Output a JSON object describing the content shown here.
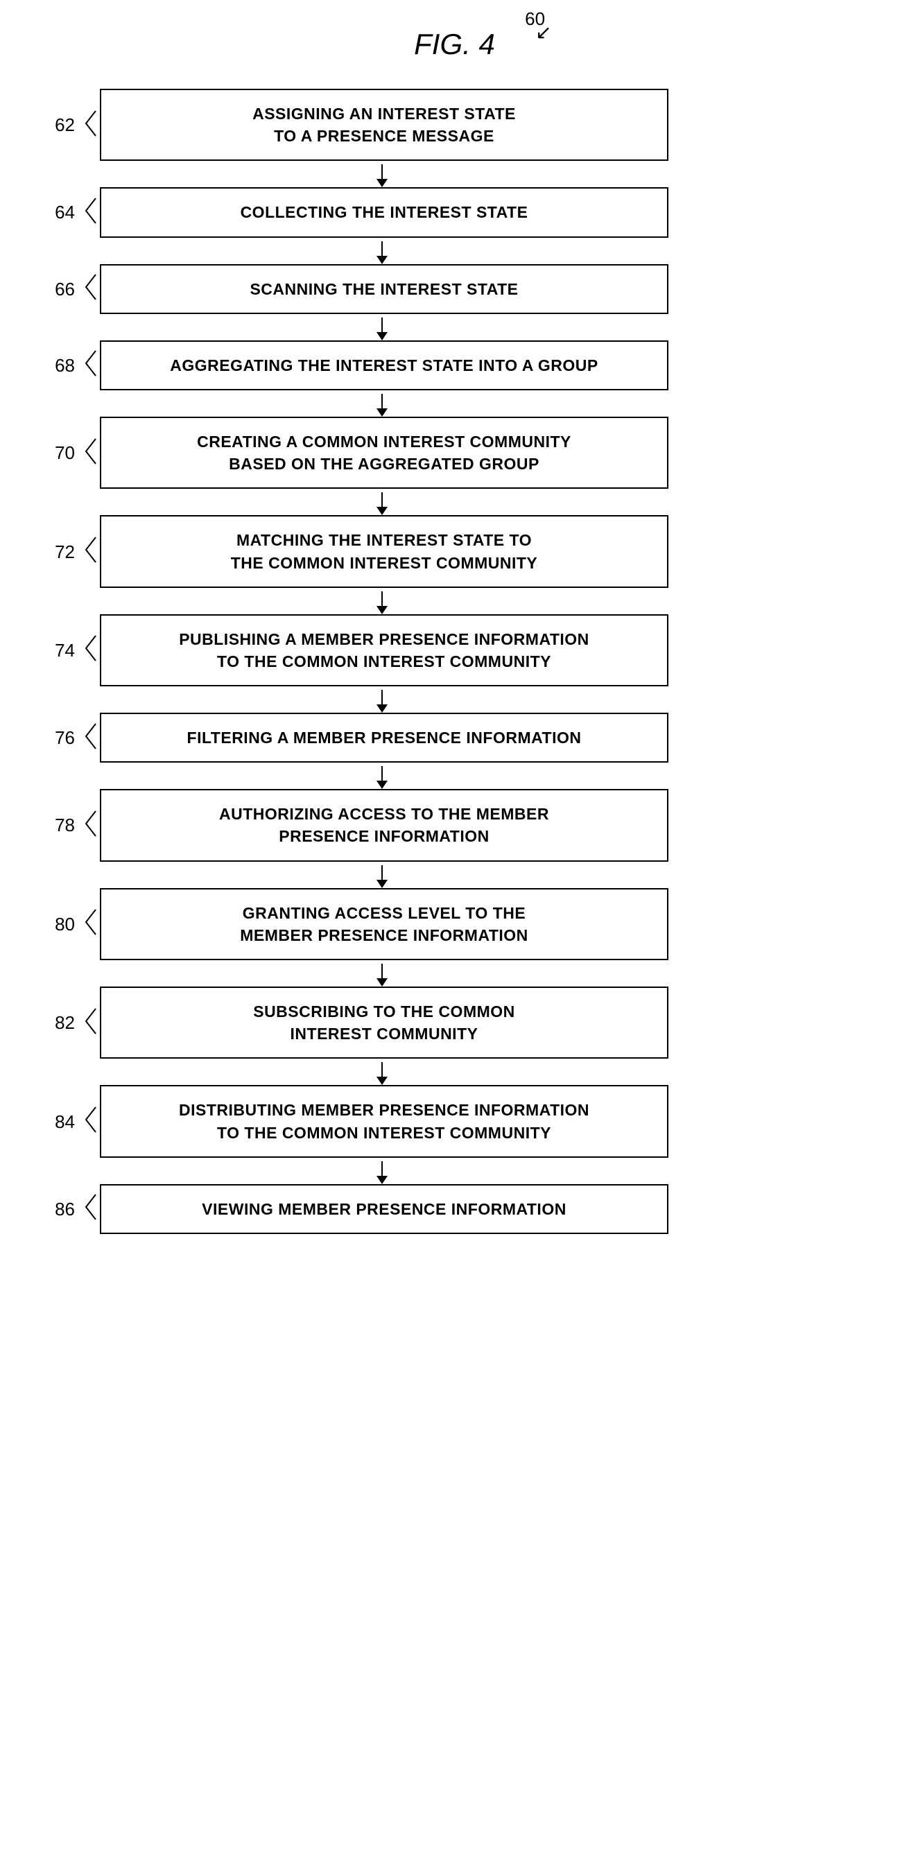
{
  "figure": {
    "title": "FIG. 4",
    "number": "60"
  },
  "steps": [
    {
      "id": "step-62",
      "number": "62",
      "label": "ASSIGNING AN INTEREST STATE\nTO A PRESENCE MESSAGE"
    },
    {
      "id": "step-64",
      "number": "64",
      "label": "COLLECTING THE INTEREST STATE"
    },
    {
      "id": "step-66",
      "number": "66",
      "label": "SCANNING THE INTEREST STATE"
    },
    {
      "id": "step-68",
      "number": "68",
      "label": "AGGREGATING THE INTEREST STATE INTO A GROUP"
    },
    {
      "id": "step-70",
      "number": "70",
      "label": "CREATING A COMMON INTEREST COMMUNITY\nBASED ON THE AGGREGATED GROUP"
    },
    {
      "id": "step-72",
      "number": "72",
      "label": "MATCHING THE INTEREST STATE TO\nTHE COMMON INTEREST COMMUNITY"
    },
    {
      "id": "step-74",
      "number": "74",
      "label": "PUBLISHING A MEMBER PRESENCE INFORMATION\nTO THE COMMON INTEREST COMMUNITY"
    },
    {
      "id": "step-76",
      "number": "76",
      "label": "FILTERING A MEMBER PRESENCE INFORMATION"
    },
    {
      "id": "step-78",
      "number": "78",
      "label": "AUTHORIZING ACCESS TO THE MEMBER\nPRESENCE INFORMATION"
    },
    {
      "id": "step-80",
      "number": "80",
      "label": "GRANTING ACCESS LEVEL TO THE\nMEMBER PRESENCE INFORMATION"
    },
    {
      "id": "step-82",
      "number": "82",
      "label": "SUBSCRIBING TO THE COMMON\nINTEREST COMMUNITY"
    },
    {
      "id": "step-84",
      "number": "84",
      "label": "DISTRIBUTING MEMBER PRESENCE INFORMATION\nTO THE COMMON INTEREST COMMUNITY"
    },
    {
      "id": "step-86",
      "number": "86",
      "label": "VIEWING MEMBER PRESENCE INFORMATION"
    }
  ]
}
